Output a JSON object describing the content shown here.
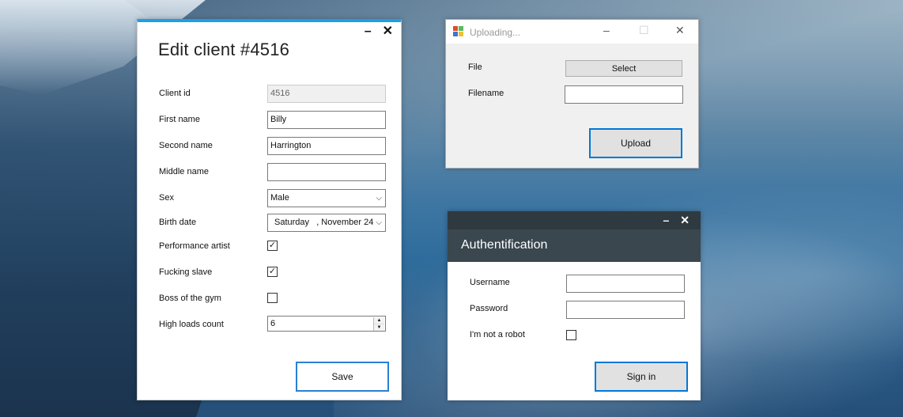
{
  "edit_client": {
    "title": "Edit client #4516",
    "window_controls": {
      "minimize": "–",
      "close": "✕"
    },
    "fields": {
      "client_id": {
        "label": "Client id",
        "value": "4516"
      },
      "first_name": {
        "label": "First name",
        "value": "Billy"
      },
      "second_name": {
        "label": "Second name",
        "value": "Harrington"
      },
      "middle_name": {
        "label": "Middle name",
        "value": ""
      },
      "sex": {
        "label": "Sex",
        "value": "Male"
      },
      "birth_date": {
        "label": "Birth date",
        "value": "Saturday   , November 24"
      },
      "performance_artist": {
        "label": "Performance artist",
        "checked": true
      },
      "fucking_slave": {
        "label": "Fucking slave",
        "checked": true
      },
      "boss_of_the_gym": {
        "label": "Boss of the gym",
        "checked": false
      },
      "high_loads_count": {
        "label": "High loads count",
        "value": "6"
      }
    },
    "save_label": "Save",
    "accent_color": "#1ba1e2"
  },
  "uploading": {
    "title": "Uploading...",
    "file_label": "File",
    "select_label": "Select",
    "filename_label": "Filename",
    "filename_value": "",
    "upload_label": "Upload"
  },
  "auth": {
    "title": "Authentification",
    "window_controls": {
      "minimize": "–",
      "close": "✕"
    },
    "username_label": "Username",
    "username_value": "",
    "password_label": "Password",
    "password_value": "",
    "robot_label": "I'm not a robot",
    "robot_checked": false,
    "signin_label": "Sign in",
    "header_color": "#3a474e"
  },
  "glyphs": {
    "check": "✓",
    "chevron": "⌵",
    "up": "▲",
    "down": "▼"
  }
}
